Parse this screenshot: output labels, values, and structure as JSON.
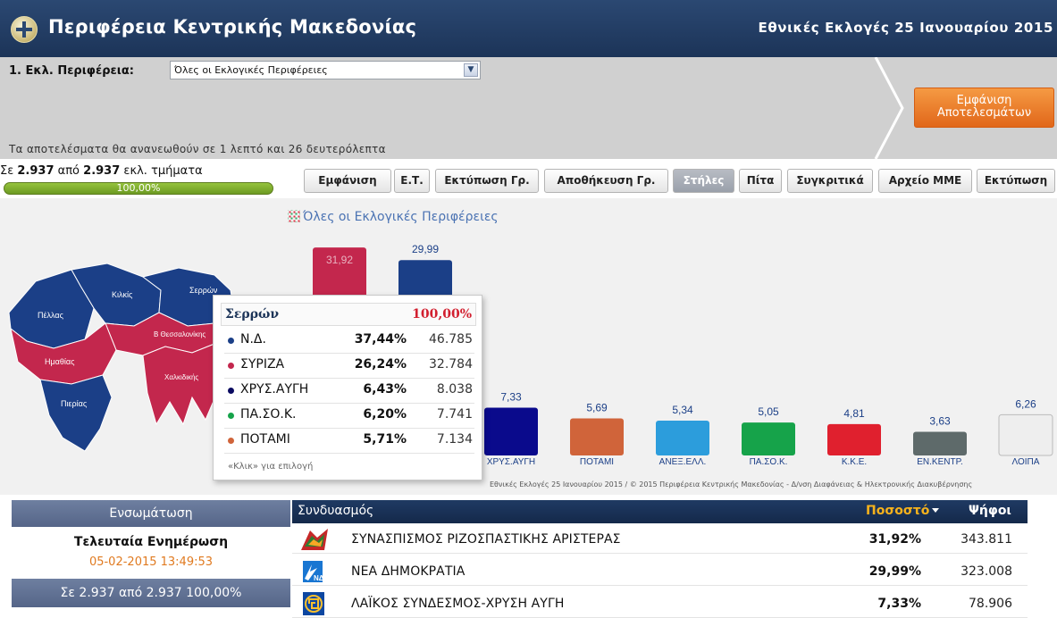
{
  "header": {
    "title": "Περιφέρεια Κεντρικής Μακεδονίας",
    "election": "Εθνικές Εκλογές 25 Ιανουαρίου 2015"
  },
  "selector": {
    "label": "1. Εκλ. Περιφέρεια:",
    "value": "Όλες οι Εκλογικές Περιφέρειες"
  },
  "refresh_text": "Τα αποτελέσματα θα ανανεωθούν σε 1 λεπτό και 26 δευτερόλεπτα",
  "show_button": [
    "Εμφάνιση",
    "Αποτελεσμάτων"
  ],
  "sections": {
    "prefix": "Σε",
    "counted": "2.937",
    "middle": "από",
    "total": "2.937",
    "suffix": "εκλ. τμήματα",
    "percent": "100,00%"
  },
  "toolbar": [
    "Εμφάνιση",
    "Ε.Τ.",
    "Εκτύπωση Γρ.",
    "Αποθήκευση Γρ.",
    "Στήλες",
    "Πίτα",
    "Συγκριτικά",
    "Αρχείο ΜΜΕ",
    "Εκτύπωση"
  ],
  "toolbar_active": "Στήλες",
  "chart_data": {
    "type": "bar",
    "title": "Όλες οι Εκλογικές Περιφέρειες",
    "categories": [
      "ΣΥΡΙΖΑ",
      "Ν.Δ.",
      "ΧΡΥΣ.ΑΥΓΗ",
      "ΠΟΤΑΜΙ",
      "ΑΝΕΞ.ΕΛΛ.",
      "ΠΑ.ΣΟ.Κ.",
      "Κ.Κ.Ε.",
      "ΕΝ.ΚΕΝΤΡ.",
      "ΛΟΙΠΑ"
    ],
    "values": [
      31.92,
      29.99,
      7.33,
      5.69,
      5.34,
      5.05,
      4.81,
      3.63,
      6.26
    ],
    "value_labels": [
      "31,92",
      "29,99",
      "7,33",
      "5,69",
      "5,34",
      "5,05",
      "4,81",
      "3,63",
      "6,26"
    ],
    "colors": [
      "#c3274d",
      "#1b3f87",
      "#0a0a8c",
      "#d0643a",
      "#2c9ddc",
      "#16a34a",
      "#e0202e",
      "#5e6a6a",
      "#eeeeee"
    ],
    "ylim": [
      0,
      34
    ]
  },
  "credits": "Εθνικές Εκλογές 25 Ιανουαρίου 2015 / © 2015 Περιφέρεια Κεντρικής Μακεδονίας - Δ/νση Διαφάνειας & Ηλεκτρονικής Διακυβέρνησης",
  "map": {
    "regions": [
      {
        "name": "Πέλλας",
        "color": "#1b3f87"
      },
      {
        "name": "Κιλκίς",
        "color": "#1b3f87"
      },
      {
        "name": "Σερρών",
        "color": "#1b3f87"
      },
      {
        "name": "Β Θεσσαλονίκης",
        "color": "#c3274d"
      },
      {
        "name": "Ημαθίας",
        "color": "#c3274d"
      },
      {
        "name": "Χαλκιδικής",
        "color": "#c3274d"
      },
      {
        "name": "Πιερίας",
        "color": "#1b3f87"
      }
    ]
  },
  "tooltip": {
    "region": "Σερρών",
    "percent": "100,00%",
    "rows": [
      {
        "party": "Ν.Δ.",
        "pct": "37,44%",
        "votes": "46.785",
        "color": "#1b3f87"
      },
      {
        "party": "ΣΥΡΙΖΑ",
        "pct": "26,24%",
        "votes": "32.784",
        "color": "#c3274d"
      },
      {
        "party": "ΧΡΥΣ.ΑΥΓΗ",
        "pct": "6,43%",
        "votes": "8.038",
        "color": "#0a0a60"
      },
      {
        "party": "ΠΑ.ΣΟ.Κ.",
        "pct": "6,20%",
        "votes": "7.741",
        "color": "#16a34a"
      },
      {
        "party": "ΠΟΤΑΜΙ",
        "pct": "5,71%",
        "votes": "7.134",
        "color": "#d0643a"
      }
    ],
    "hint": "«Κλικ» για επιλογή"
  },
  "left_panel": {
    "title": "Ενσωμάτωση",
    "last_update_label": "Τελευταία Ενημέρωση",
    "last_update": "05-02-2015 13:49:53",
    "footer": "Σε 2.937  από  2.937   100,00%"
  },
  "table": {
    "headers": {
      "combination": "Συνδυασμός",
      "percent": "Ποσοστό",
      "votes": "Ψήφοι"
    },
    "rows": [
      {
        "name": "ΣΥΝΑΣΠΙΣΜΟΣ ΡΙΖΟΣΠΑΣΤΙΚΗΣ ΑΡΙΣΤΕΡΑΣ",
        "pct": "31,92%",
        "votes": "343.811",
        "logo": "syriza-logo"
      },
      {
        "name": "ΝΕΑ ΔΗΜΟΚΡΑΤΙΑ",
        "pct": "29,99%",
        "votes": "323.008",
        "logo": "nd-logo"
      },
      {
        "name": "ΛΑΪΚΟΣ ΣΥΝΔΕΣΜΟΣ-ΧΡΥΣΗ ΑΥΓΗ",
        "pct": "7,33%",
        "votes": "78.906",
        "logo": "golden-dawn-logo"
      }
    ]
  }
}
